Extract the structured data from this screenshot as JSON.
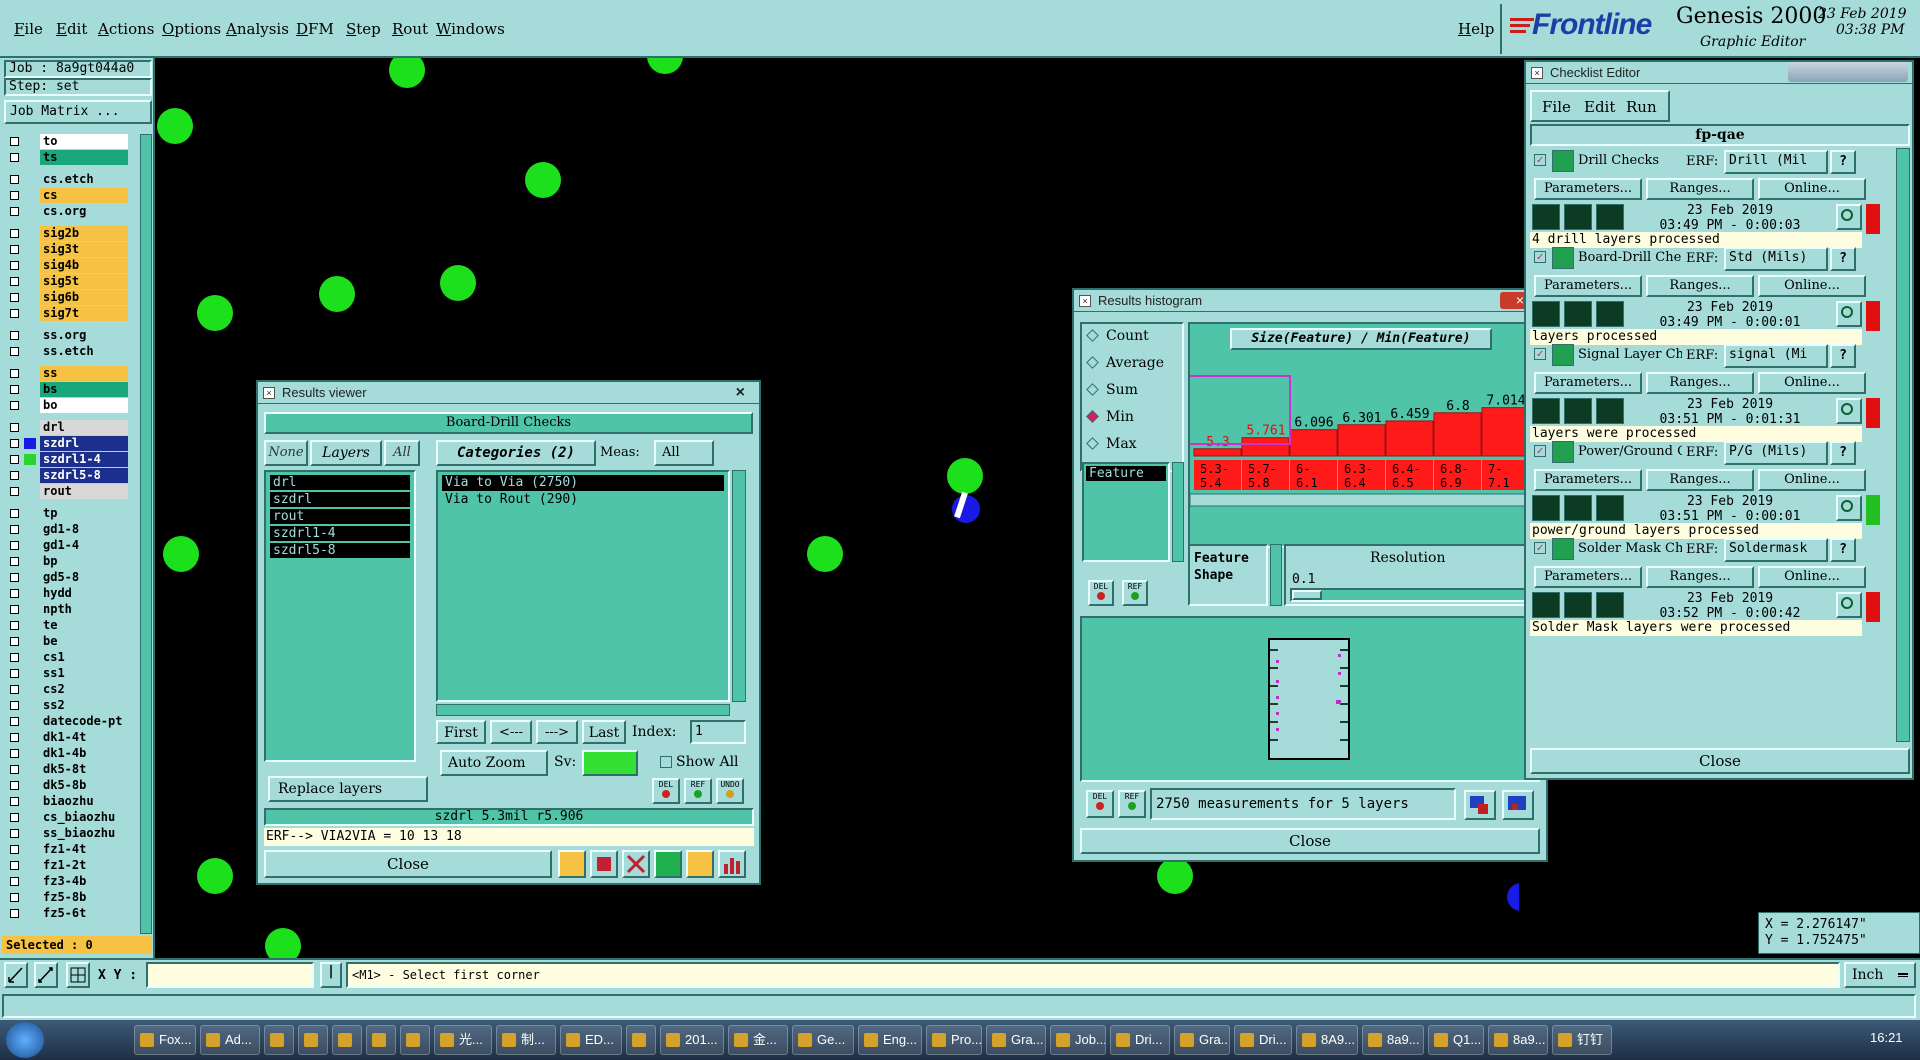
{
  "menubar": {
    "items": [
      "File",
      "Edit",
      "Actions",
      "Options",
      "Analysis",
      "DFM",
      "Step",
      "Rout",
      "Windows"
    ],
    "help": "Help",
    "brand": "Frontline",
    "product": "Genesis 2000",
    "product_sub": "Graphic Editor",
    "date": "23 Feb 2019",
    "time": "03:38 PM"
  },
  "left": {
    "job": "Job : 8a9gt044a0",
    "step": "Step: set",
    "job_matrix": "Job Matrix ...",
    "selected": "Selected : 0",
    "layers": [
      {
        "name": "to",
        "color": "#ffffff"
      },
      {
        "name": "ts",
        "color": "#19a87c"
      },
      {
        "name": "cs.etch",
        "color": "#a5dcd9"
      },
      {
        "name": "cs",
        "color": "#f5c243"
      },
      {
        "name": "cs.org",
        "color": "#a5dcd9"
      },
      {
        "name": "sig2b",
        "color": "#f5c243"
      },
      {
        "name": "sig3t",
        "color": "#f5c243"
      },
      {
        "name": "sig4b",
        "color": "#f5c243"
      },
      {
        "name": "sig5t",
        "color": "#f5c243"
      },
      {
        "name": "sig6b",
        "color": "#f5c243"
      },
      {
        "name": "sig7t",
        "color": "#f5c243"
      },
      {
        "name": "ss.org",
        "color": "#a5dcd9"
      },
      {
        "name": "ss.etch",
        "color": "#a5dcd9"
      },
      {
        "name": "ss",
        "color": "#f5c243"
      },
      {
        "name": "bs",
        "color": "#19a87c"
      },
      {
        "name": "bo",
        "color": "#ffffff"
      },
      {
        "name": "drl",
        "color": "#d8d8d8"
      },
      {
        "name": "szdrl",
        "color": "#1c2f8c"
      },
      {
        "name": "szdrl1-4",
        "color": "#1c2f8c"
      },
      {
        "name": "szdrl5-8",
        "color": "#1c2f8c"
      },
      {
        "name": "rout",
        "color": "#d8d8d8"
      },
      {
        "name": "tp",
        "color": "#a5dcd9"
      },
      {
        "name": "gd1-8",
        "color": "#a5dcd9"
      },
      {
        "name": "gd1-4",
        "color": "#a5dcd9"
      },
      {
        "name": "bp",
        "color": "#a5dcd9"
      },
      {
        "name": "gd5-8",
        "color": "#a5dcd9"
      },
      {
        "name": "hydd",
        "color": "#a5dcd9"
      },
      {
        "name": "npth",
        "color": "#a5dcd9"
      },
      {
        "name": "te",
        "color": "#a5dcd9"
      },
      {
        "name": "be",
        "color": "#a5dcd9"
      },
      {
        "name": "cs1",
        "color": "#a5dcd9"
      },
      {
        "name": "ss1",
        "color": "#a5dcd9"
      },
      {
        "name": "cs2",
        "color": "#a5dcd9"
      },
      {
        "name": "ss2",
        "color": "#a5dcd9"
      },
      {
        "name": "datecode-pt",
        "color": "#a5dcd9"
      },
      {
        "name": "dk1-4t",
        "color": "#a5dcd9"
      },
      {
        "name": "dk1-4b",
        "color": "#a5dcd9"
      },
      {
        "name": "dk5-8t",
        "color": "#a5dcd9"
      },
      {
        "name": "dk5-8b",
        "color": "#a5dcd9"
      },
      {
        "name": "biaozhu",
        "color": "#a5dcd9"
      },
      {
        "name": "cs_biaozhu",
        "color": "#a5dcd9"
      },
      {
        "name": "ss_biaozhu",
        "color": "#a5dcd9"
      },
      {
        "name": "fz1-4t",
        "color": "#a5dcd9"
      },
      {
        "name": "fz1-2t",
        "color": "#a5dcd9"
      },
      {
        "name": "fz3-4b",
        "color": "#a5dcd9"
      },
      {
        "name": "fz5-8b",
        "color": "#a5dcd9"
      },
      {
        "name": "fz5-6t",
        "color": "#a5dcd9"
      }
    ]
  },
  "bottom": {
    "xy_label": "X Y :",
    "xy_value": "",
    "prompt": "<M1> - Select first corner",
    "units": "Inch",
    "coords_x": "X = 2.276147\"",
    "coords_y": "Y = 1.752475\""
  },
  "results_viewer": {
    "title": "Results viewer",
    "header": "Board-Drill Checks",
    "none": "None",
    "layers": "Layers",
    "all": "All",
    "categories": "Categories (2)",
    "meas_label": "Meas:",
    "meas_value": "All",
    "layer_list": [
      "drl",
      "szdrl",
      "rout",
      "szdrl1-4",
      "szdrl5-8"
    ],
    "category_list": [
      "Via to Via  (2750)",
      "Via to Rout  (290)"
    ],
    "first": "First",
    "prev": "<---",
    "next": "--->",
    "last": "Last",
    "index_label": "Index:",
    "index_value": "1",
    "auto_zoom": "Auto Zoom",
    "sv_label": "Sv:",
    "show_all": "Show All",
    "replace_layers": "Replace layers",
    "del": "DEL",
    "ref": "REF",
    "undo": "UNDO",
    "status": "szdrl 5.3mil  r5.906",
    "erf": "ERF--> VIA2VIA = 10 13 18",
    "close": "Close"
  },
  "histogram": {
    "title": "Results histogram",
    "options": [
      "Count",
      "Average",
      "Sum",
      "Min",
      "Max"
    ],
    "selected_option": "Min",
    "feature_label": "Feature",
    "chart_title": "Size(Feature) / Min(Feature)",
    "feature_shape": [
      "Feature",
      "Shape"
    ],
    "resolution_label": "Resolution",
    "resolution_value": "0.1",
    "del": "DEL",
    "ref": "REF",
    "measurements": "2750 measurements for 5 layers",
    "close": "Close"
  },
  "chart_data": {
    "type": "bar",
    "title": "Size(Feature) / Min(Feature)",
    "categories": [
      "5.3-5.4",
      "5.7-5.8",
      "6-6.1",
      "6.3-6.4",
      "6.4-6.5",
      "6.8-6.9",
      "7-7.1"
    ],
    "values": [
      5.3,
      5.761,
      6.096,
      6.301,
      6.459,
      6.8,
      7.014
    ],
    "value_labels": [
      "5.3",
      "5.761",
      "6.096",
      "6.301",
      "6.459",
      "6.8",
      "7.014"
    ],
    "category_top": [
      "5.3-",
      "5.7-",
      "6-",
      "6.3-",
      "6.4-",
      "6.8-",
      "7-"
    ],
    "category_bottom": [
      "5.4",
      "5.8",
      "6.1",
      "6.4",
      "6.5",
      "6.9",
      "7.1"
    ],
    "bar_color": "#ff1a1a",
    "highlight_color": "#cc33cc"
  },
  "checklist": {
    "title": "Checklist Editor",
    "menu": [
      "File",
      "Edit",
      "Run"
    ],
    "name": "fp-qae",
    "erf_label": "ERF:",
    "params": "Parameters...",
    "ranges": "Ranges...",
    "online": "Online...",
    "close": "Close",
    "actions": [
      {
        "name": "Drill Checks",
        "erf": "Drill (Mil",
        "date": "23 Feb 2019",
        "time": "03:49 PM - 0:00:03",
        "msg": "4 drill layers processed",
        "status_color": "#e01010"
      },
      {
        "name": "Board-Drill Che",
        "erf": "Std (Mils)",
        "date": "23 Feb 2019",
        "time": "03:49 PM - 0:00:01",
        "msg": " layers processed",
        "status_color": "#e01010"
      },
      {
        "name": "Signal Layer Ch",
        "erf": "signal (Mi",
        "date": "23 Feb 2019",
        "time": "03:51 PM - 0:01:31",
        "msg": " layers were processed",
        "status_color": "#e01010"
      },
      {
        "name": "Power/Ground C",
        "erf": "P/G (Mils)",
        "date": "23 Feb 2019",
        "time": "03:51 PM - 0:00:01",
        "msg": " power/ground layers processed",
        "status_color": "#22c022"
      },
      {
        "name": "Solder Mask Ch",
        "erf": "Soldermask",
        "date": "23 Feb 2019",
        "time": "03:52 PM - 0:00:42",
        "msg": " Solder Mask layers were processed",
        "status_color": "#e01010"
      }
    ]
  },
  "taskbar": {
    "items": [
      "Fox...",
      "Ad...",
      "",
      "",
      "",
      "",
      "",
      "光...",
      "制...",
      "ED...",
      "",
      "201...",
      "金...",
      "Ge...",
      "Eng...",
      "Pro...",
      "Gra...",
      "Job...",
      "Dri...",
      "Gra...",
      "Dri...",
      "8A9...",
      "8a9...",
      "Q1...",
      "8a9...",
      "钉钉"
    ],
    "clock": "16:21"
  }
}
